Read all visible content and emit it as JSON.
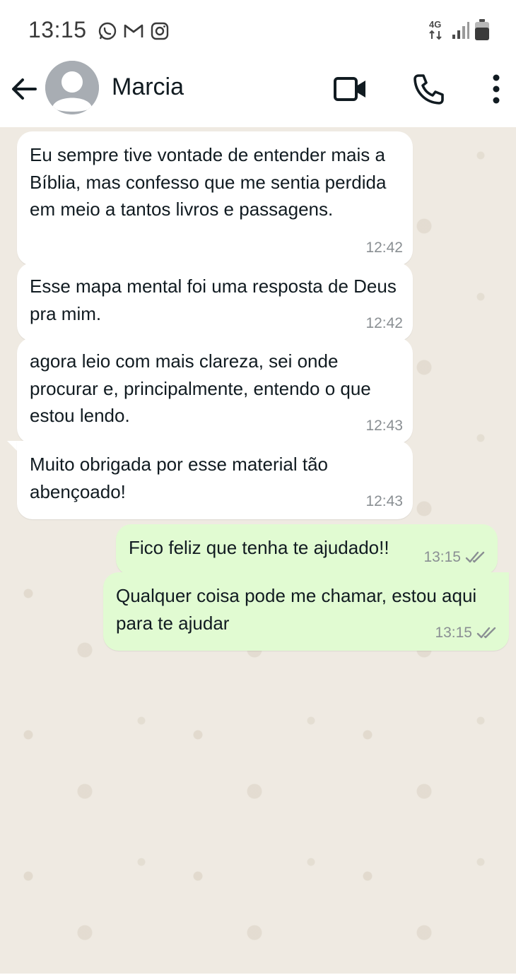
{
  "status_bar": {
    "time": "13:15",
    "app_icons": [
      "whatsapp-icon",
      "gmail-icon",
      "instagram-icon"
    ],
    "network": "4G",
    "system_icons": [
      "network-4g-icon",
      "signal-icon",
      "battery-icon"
    ]
  },
  "header": {
    "contact_name": "Marcia",
    "back_icon": "arrow-left-icon",
    "actions": [
      "video-call-icon",
      "voice-call-icon",
      "more-vert-icon"
    ]
  },
  "messages": [
    {
      "direction": "in",
      "text": "Eu sempre tive vontade de entender mais a Bíblia, mas confesso que me sentia perdida em meio a tantos livros e passagens.",
      "time": "12:42"
    },
    {
      "direction": "in",
      "text": "Esse mapa mental foi uma resposta de Deus pra mim.",
      "time": "12:42"
    },
    {
      "direction": "in",
      "text": "agora leio com mais clareza, sei onde procurar e, principalmente, entendo o que estou lendo.",
      "time": "12:43"
    },
    {
      "direction": "in",
      "text": "Muito obrigada por esse material tão abençoado!",
      "time": "12:43"
    },
    {
      "direction": "out",
      "text": "Fico feliz que tenha te ajudado!!",
      "time": "13:15",
      "status_icon": "double-check-icon"
    },
    {
      "direction": "out",
      "text": "Qualquer coisa pode me chamar, estou aqui para te ajudar",
      "time": "13:15",
      "status_icon": "double-check-icon"
    }
  ],
  "colors": {
    "chat_background": "#efeae2",
    "incoming_bubble": "#ffffff",
    "outgoing_bubble": "#e1fbd2",
    "timestamp": "#8a8f93"
  }
}
